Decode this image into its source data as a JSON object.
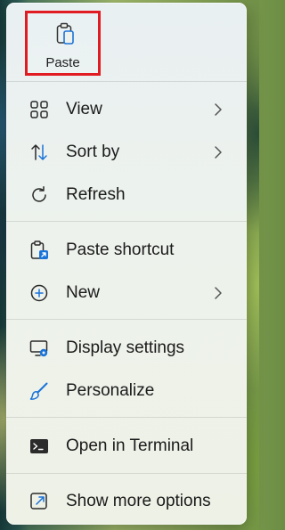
{
  "context_menu": {
    "quick_actions": {
      "paste": {
        "label": "Paste",
        "icon": "clipboard-icon"
      }
    },
    "items": [
      {
        "label": "View",
        "icon": "grid-icon",
        "has_submenu": true
      },
      {
        "label": "Sort by",
        "icon": "sort-arrows-icon",
        "has_submenu": true
      },
      {
        "label": "Refresh",
        "icon": "refresh-icon",
        "has_submenu": false
      },
      {
        "label": "Paste shortcut",
        "icon": "paste-shortcut-icon",
        "has_submenu": false
      },
      {
        "label": "New",
        "icon": "plus-circle-icon",
        "has_submenu": true
      },
      {
        "label": "Display settings",
        "icon": "display-settings-icon",
        "has_submenu": false
      },
      {
        "label": "Personalize",
        "icon": "brush-icon",
        "has_submenu": false
      },
      {
        "label": "Open in Terminal",
        "icon": "terminal-icon",
        "has_submenu": false
      },
      {
        "label": "Show more options",
        "icon": "show-more-icon",
        "has_submenu": false
      }
    ]
  },
  "colors": {
    "highlight_border": "#e11b22",
    "accent_blue": "#1a73d9",
    "text": "#1b1b1b"
  }
}
